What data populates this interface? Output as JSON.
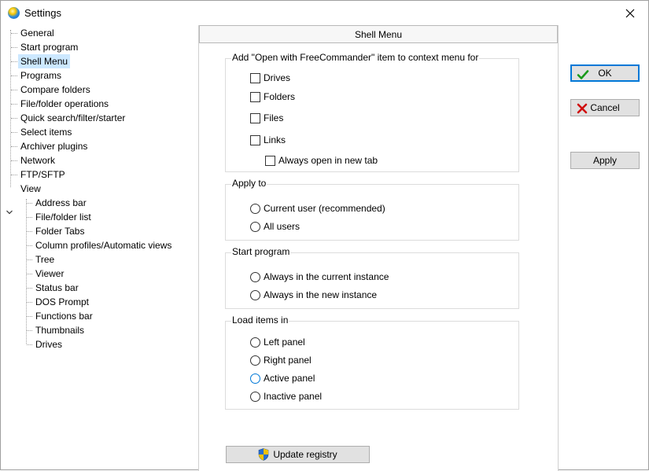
{
  "window": {
    "title": "Settings"
  },
  "tree": {
    "items": [
      {
        "label": "General",
        "level": 0
      },
      {
        "label": "Start program",
        "level": 0
      },
      {
        "label": "Shell Menu",
        "level": 0,
        "selected": true
      },
      {
        "label": "Programs",
        "level": 0
      },
      {
        "label": "Compare folders",
        "level": 0
      },
      {
        "label": "File/folder operations",
        "level": 0
      },
      {
        "label": "Quick search/filter/starter",
        "level": 0
      },
      {
        "label": "Select items",
        "level": 0
      },
      {
        "label": "Archiver plugins",
        "level": 0
      },
      {
        "label": "Network",
        "level": 0
      },
      {
        "label": "FTP/SFTP",
        "level": 0
      },
      {
        "label": "View",
        "level": 0,
        "expanded": true
      },
      {
        "label": "Address bar",
        "level": 1
      },
      {
        "label": "File/folder list",
        "level": 1
      },
      {
        "label": "Folder Tabs",
        "level": 1
      },
      {
        "label": "Column profiles/Automatic views",
        "level": 1
      },
      {
        "label": "Tree",
        "level": 1
      },
      {
        "label": "Viewer",
        "level": 1
      },
      {
        "label": "Status bar",
        "level": 1
      },
      {
        "label": "DOS Prompt",
        "level": 1
      },
      {
        "label": "Functions bar",
        "level": 1
      },
      {
        "label": "Thumbnails",
        "level": 1
      },
      {
        "label": "Drives",
        "level": 1
      }
    ]
  },
  "panel": {
    "header": "Shell Menu",
    "context_group": {
      "title": "Add \"Open with FreeCommander\" item to context menu for",
      "drives": "Drives",
      "folders": "Folders",
      "files": "Files",
      "links": "Links",
      "new_tab": "Always open in new tab"
    },
    "apply_group": {
      "title": "Apply to",
      "current_user": "Current user (recommended)",
      "all_users": "All users"
    },
    "start_group": {
      "title": "Start program",
      "current_instance": "Always in the current instance",
      "new_instance": "Always in the new instance"
    },
    "load_group": {
      "title": "Load items in",
      "left": "Left panel",
      "right": "Right panel",
      "active": "Active panel",
      "inactive": "Inactive panel"
    },
    "update_button": "Update registry"
  },
  "buttons": {
    "ok": "OK",
    "cancel": "Cancel",
    "apply": "Apply"
  },
  "colors": {
    "accent": "#0078d7",
    "selection": "#cce8ff",
    "ok_check": "#1a9a1a",
    "cancel_x": "#d01010"
  }
}
